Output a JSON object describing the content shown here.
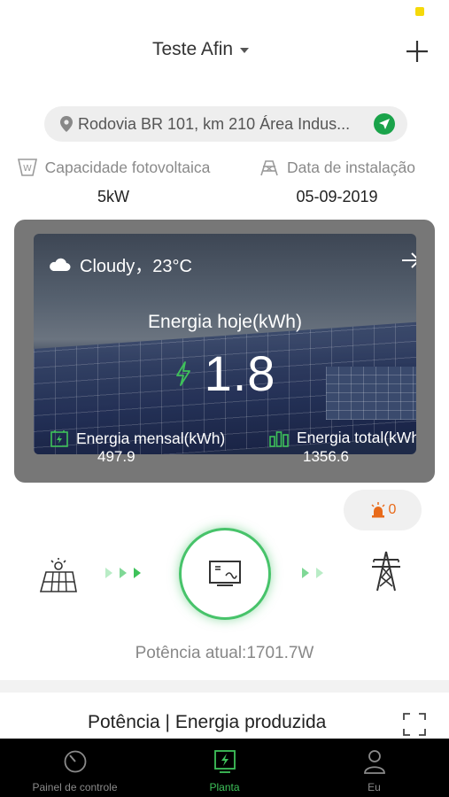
{
  "header": {
    "plant_name": "Teste Afin"
  },
  "address": {
    "text": "Rodovia BR 101, km 210 Área Indus..."
  },
  "plant_info": {
    "capacity_label": "Capacidade fotovoltaica",
    "capacity_value": "5kW",
    "install_label": "Data de instalação",
    "install_value": "05-09-2019"
  },
  "weather_card": {
    "weather_text": "Cloudy，23°C",
    "energy_today_label": "Energia hoje(kWh)",
    "energy_today_value": "1.8",
    "monthly_label": "Energia mensal(kWh)",
    "monthly_value": "497.9",
    "total_label": "Energia total(kWh)",
    "total_value": "1356.6"
  },
  "alarm": {
    "count": "0"
  },
  "flow": {
    "current_power": "Potência atual:1701.7W"
  },
  "section": {
    "title": "Potência | Energia produzida"
  },
  "tabbar": {
    "tabs": [
      {
        "label": "Painel de controle",
        "icon": "dashboard-icon",
        "active": false
      },
      {
        "label": "Planta",
        "icon": "plant-icon",
        "active": true
      },
      {
        "label": "Eu",
        "icon": "user-icon",
        "active": false
      }
    ]
  },
  "colors": {
    "accent_green": "#3ec25a",
    "alarm_orange": "#e86a1a",
    "nav_green": "#1aa34a"
  }
}
